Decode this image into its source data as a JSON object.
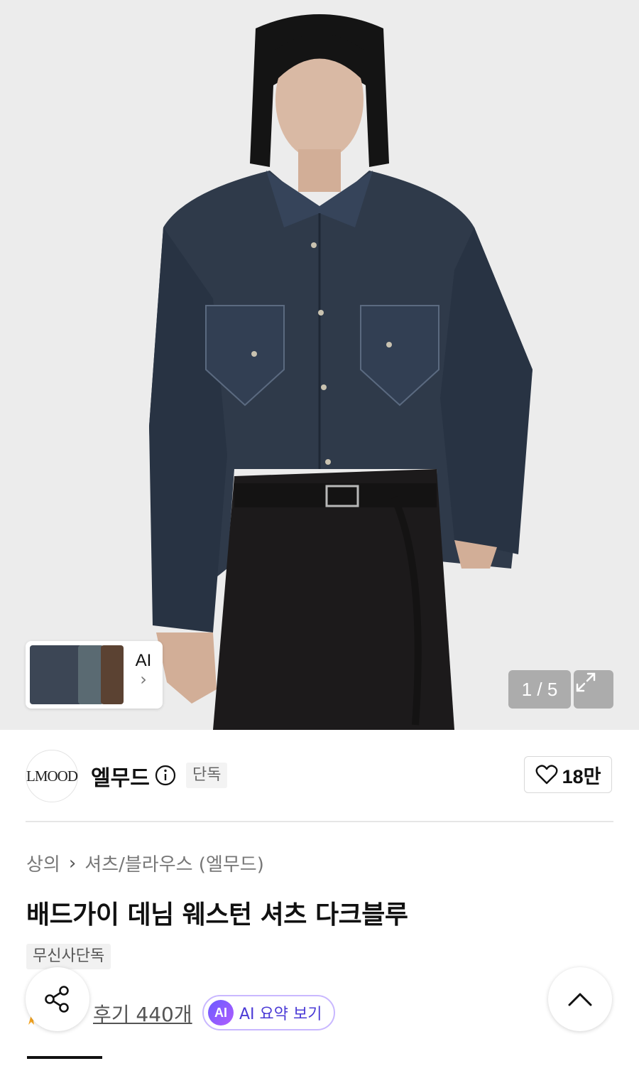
{
  "gallery": {
    "counter": "1 / 5",
    "ai_label": "AI",
    "ai_chevron": "›",
    "image_subject": "model-wearing-denim-western-shirt"
  },
  "brand": {
    "logo_text": "LMOOD",
    "name": "엘무드",
    "exclusive_badge": "단독",
    "likes": "18만"
  },
  "breadcrumb": {
    "items": [
      "상의",
      "셔츠/블라우스 (엘무드)"
    ],
    "separator": "›"
  },
  "product": {
    "title": "배드가이 데님 웨스턴 셔츠 다크블루",
    "badge": "무신사단독",
    "reviews": "후기 440개",
    "ai_summary_badge": "AI",
    "ai_summary_label": "AI 요약 보기"
  },
  "colors": {
    "accent_purple": "#6a5cff",
    "background": "#ececec",
    "denim": "#2f3a4a"
  },
  "icons": [
    "info-icon",
    "heart-icon",
    "expand-icon",
    "share-icon",
    "chevron-up-icon",
    "chevron-right-icon"
  ]
}
